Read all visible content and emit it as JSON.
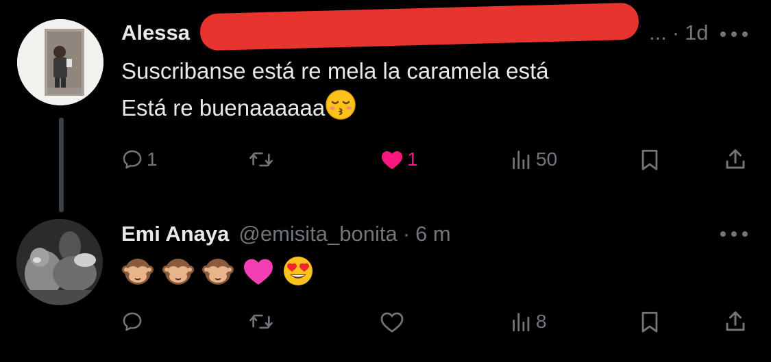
{
  "tweets": [
    {
      "name": "Alessa",
      "handle_suffix": "...",
      "time": "1d",
      "text_line1": "Suscribanse está re mela la caramela está",
      "text_line2": "Está re buenaaaaaa",
      "text_emoji": "kissing-face-with-closed-eyes",
      "actions": {
        "replies": "1",
        "retweets": "",
        "likes": "1",
        "views": "50"
      },
      "liked": true,
      "like_color": "#f91880"
    },
    {
      "name": "Emi Anaya",
      "handle": "@emisita_bonita",
      "time": "6 m",
      "text_emojis": [
        "see-no-evil-monkey",
        "see-no-evil-monkey",
        "see-no-evil-monkey",
        "pink-heart",
        "smiling-face-with-heart-eyes"
      ],
      "actions": {
        "replies": "",
        "retweets": "",
        "likes": "",
        "views": "8"
      },
      "liked": false
    }
  ],
  "separator": "·",
  "colors": {
    "background": "#000000",
    "text": "#e7e9ea",
    "muted": "#71767b",
    "like": "#f91880",
    "redaction": "#e8342e"
  }
}
